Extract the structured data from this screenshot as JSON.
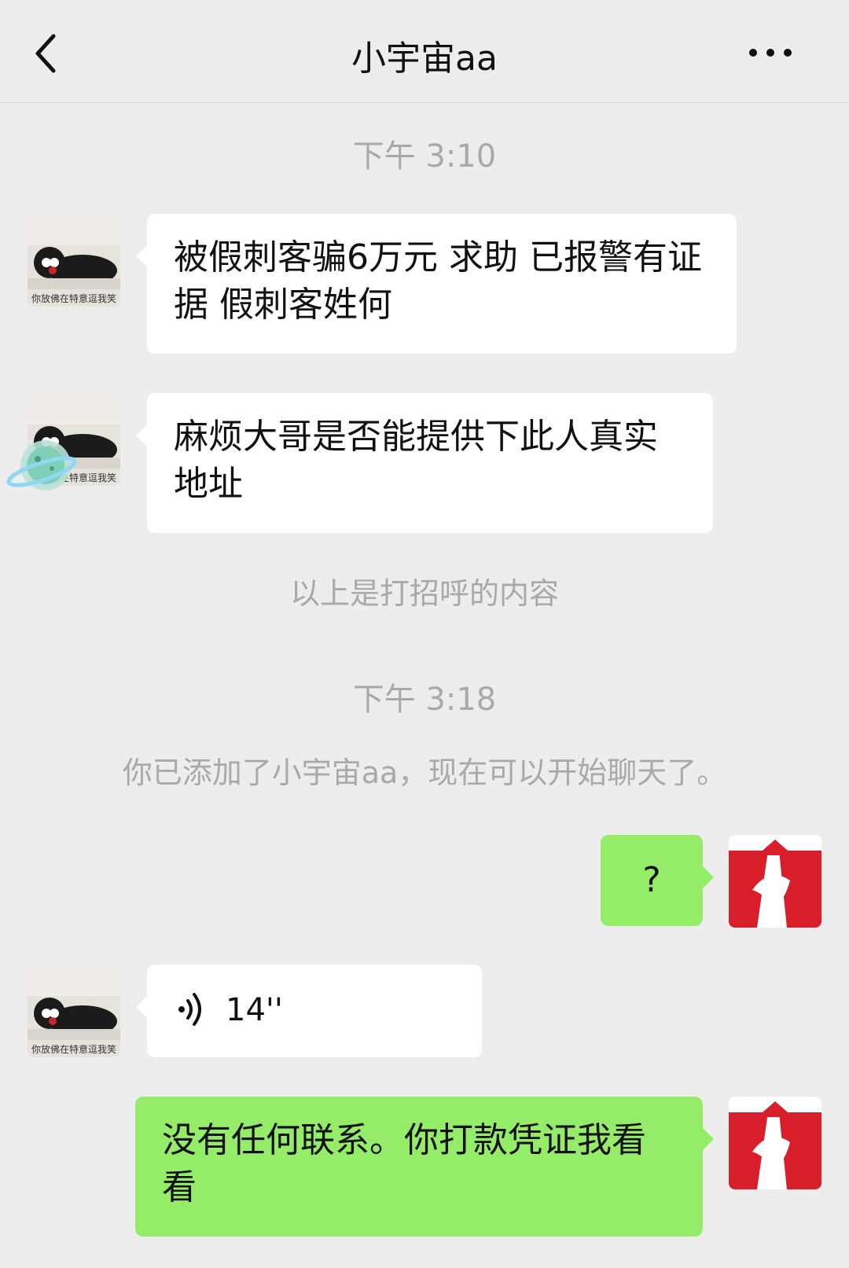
{
  "header": {
    "title": "小宇宙aa"
  },
  "messages": {
    "time1": "下午 3:10",
    "msg1": "被假刺客骗6万元 求助 已报警有证据 假刺客姓何",
    "msg2": "麻烦大哥是否能提供下此人真实地址",
    "greeting_note": "以上是打招呼的内容",
    "time2": "下午 3:18",
    "added_note": "你已添加了小宇宙aa，现在可以开始聊天了。",
    "msg3": "?",
    "voice_duration": "14''",
    "msg4": "没有任何联系。你打款凭证我看看"
  },
  "avatar": {
    "caption": "你放佛在特意逗我笑"
  },
  "colors": {
    "background": "#ededed",
    "bubble_white": "#ffffff",
    "bubble_green": "#95ec69",
    "system_text": "#a9a9a9"
  }
}
